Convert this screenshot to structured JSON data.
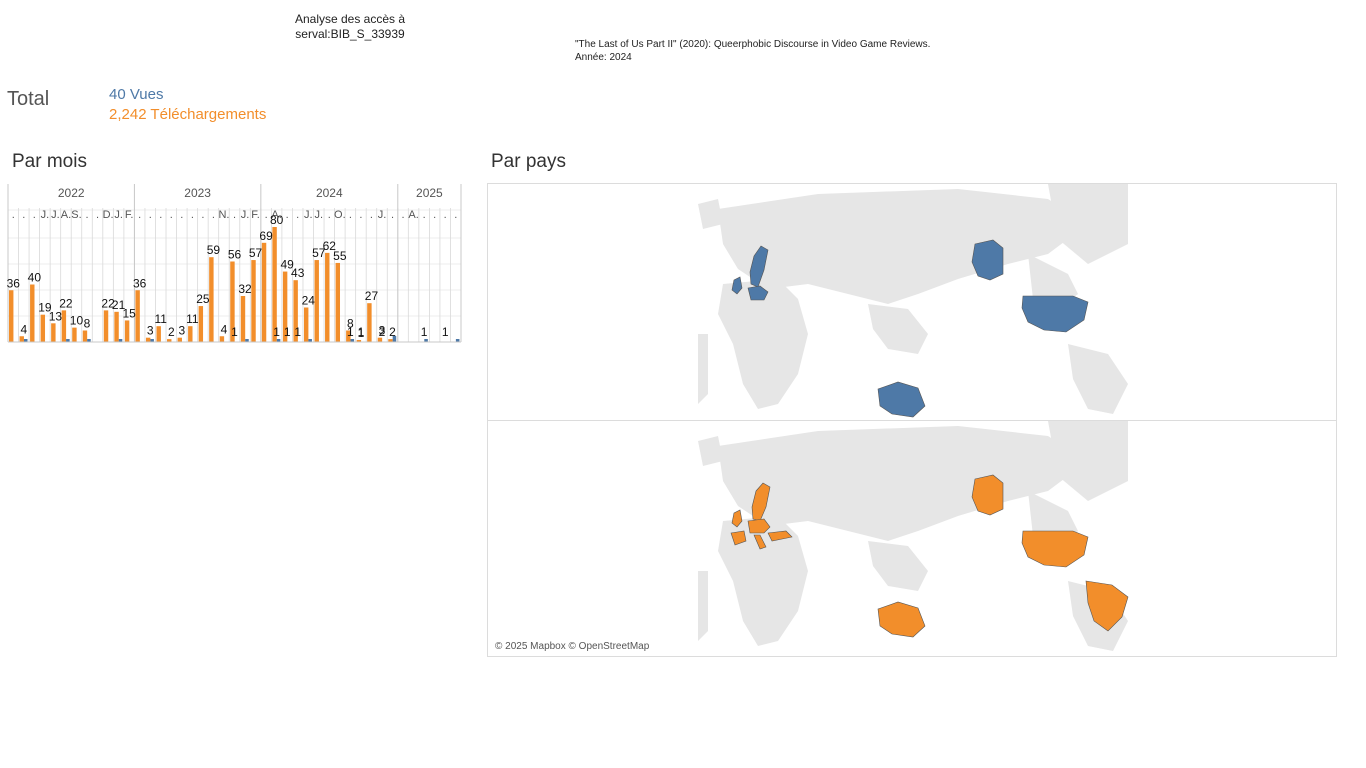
{
  "header": {
    "title_line1": "Analyse des accès à",
    "title_line2": "serval:BIB_S_33939",
    "document": "\"The Last of Us Part II\" (2020): Queerphobic Discourse in Video Game Reviews.",
    "year_line": "Année: 2024"
  },
  "totals": {
    "label": "Total",
    "views": "40 Vues",
    "downloads": "2,242 Téléchargements"
  },
  "sections": {
    "by_month": "Par mois",
    "by_country": "Par pays"
  },
  "map_credit": "© 2025 Mapbox © OpenStreetMap",
  "colors": {
    "views": "#4e79a7",
    "downloads": "#f28e2b",
    "land": "#e6e6e6",
    "ocean": "#ffffff"
  },
  "chart_data": [
    {
      "type": "bar",
      "title": "Par mois",
      "years": [
        {
          "label": "2022",
          "start": 0,
          "end": 12
        },
        {
          "label": "2023",
          "start": 12,
          "end": 24
        },
        {
          "label": "2024",
          "start": 24,
          "end": 37
        },
        {
          "label": "2025",
          "start": 37,
          "end": 43
        }
      ],
      "month_ticks": [
        ".",
        ".",
        ".",
        "J.",
        "J.",
        "A.",
        "S.",
        ".",
        ".",
        "D.",
        "J.",
        "F.",
        ".",
        ".",
        ".",
        ".",
        ".",
        ".",
        ".",
        ".",
        "N.",
        ".",
        "J.",
        "F.",
        ".",
        "A.",
        ".",
        ".",
        "J.",
        "J.",
        ".",
        "O.",
        ".",
        ".",
        ".",
        "J.",
        ".",
        ".",
        "A.",
        ".",
        ".",
        ".",
        "."
      ],
      "series": [
        {
          "name": "Vues",
          "values": [
            0,
            1,
            0,
            0,
            0,
            1,
            0,
            1,
            0,
            0,
            1,
            0,
            0,
            1,
            0,
            0,
            0,
            0,
            0,
            0,
            0,
            0,
            1,
            0,
            0,
            1,
            0,
            0,
            1,
            0,
            0,
            0,
            1,
            0,
            0,
            0,
            2,
            0,
            0,
            1,
            0,
            0,
            1
          ],
          "labels": [
            "",
            "",
            "",
            "",
            "",
            "",
            "",
            "",
            "",
            "",
            "",
            "",
            "",
            "",
            "",
            "",
            "",
            "",
            "",
            "",
            "",
            "1",
            "",
            "",
            "",
            "1",
            "1",
            "1",
            "",
            "",
            "",
            "",
            "1",
            "1",
            "",
            "2",
            "",
            "",
            "",
            "1",
            "",
            "1",
            ""
          ]
        },
        {
          "name": "Téléchargements",
          "values": [
            36,
            4,
            40,
            19,
            13,
            22,
            10,
            8,
            0,
            22,
            21,
            15,
            36,
            3,
            11,
            2,
            3,
            11,
            25,
            59,
            4,
            56,
            32,
            57,
            69,
            80,
            49,
            43,
            24,
            57,
            62,
            55,
            8,
            1,
            27,
            3,
            2,
            0,
            0,
            0,
            0,
            0,
            0
          ],
          "labels": [
            "36",
            "4",
            "40",
            "19",
            "13",
            "22",
            "10",
            "8",
            "",
            "22",
            "21",
            "15",
            "36",
            "3",
            "11",
            "2",
            "3",
            "11",
            "25",
            "59",
            "4",
            "56",
            "32",
            "57",
            "69",
            "80",
            "49",
            "43",
            "24",
            "57",
            "62",
            "55",
            "8",
            "1",
            "27",
            "3",
            "2",
            "",
            "",
            "",
            "",
            "",
            ""
          ]
        }
      ]
    },
    {
      "type": "map",
      "title": "Par pays",
      "series": [
        {
          "name": "Vues",
          "countries": [
            "United Kingdom",
            "Germany",
            "Sweden",
            "Finland",
            "United States",
            "Alaska",
            "Australia"
          ]
        },
        {
          "name": "Téléchargements",
          "countries": [
            "United Kingdom",
            "Ireland",
            "Spain",
            "France",
            "Germany",
            "Italy",
            "Sweden",
            "Greece",
            "Turkey",
            "United States",
            "Alaska",
            "Brazil",
            "Australia"
          ]
        }
      ]
    }
  ]
}
